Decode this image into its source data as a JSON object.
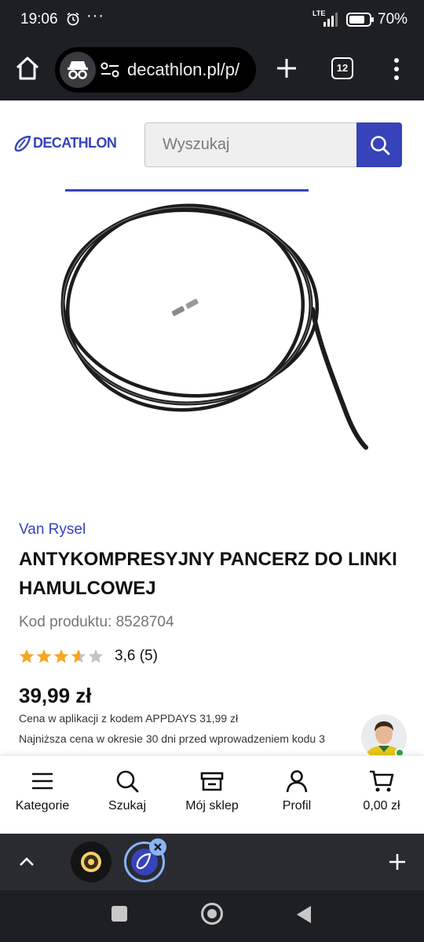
{
  "status_bar": {
    "time": "19:06",
    "network": "LTE",
    "battery": "70%",
    "more": "···"
  },
  "browser": {
    "url": "decathlon.pl/p/",
    "tab_count": "12"
  },
  "site": {
    "brand": "DECATHLON",
    "brand_color": "#3643ba",
    "search_placeholder": "Wyszukaj"
  },
  "product": {
    "brand": "Van Rysel",
    "title": "ANTYKOMPRESYJNY PANCERZ DO LINKI HAMULCOWEJ",
    "code": "Kod produktu: 8528704",
    "rating_value": 3.6,
    "rating_max": 5,
    "rating_text": "3,6 (5)",
    "price": "39,99 zł",
    "app_price_note": "Cena w aplikacji z kodem APPDAYS 31,99 zł",
    "lowest_price_note": "Najniższa cena w okresie 30 dni przed wprowadzeniem kodu 3"
  },
  "bottom_nav": {
    "items": [
      {
        "label": "Kategorie",
        "icon": "menu-icon"
      },
      {
        "label": "Szukaj",
        "icon": "search-icon"
      },
      {
        "label": "Mój sklep",
        "icon": "store-icon"
      },
      {
        "label": "Profil",
        "icon": "profile-icon"
      },
      {
        "label": "0,00 zł",
        "icon": "cart-icon"
      }
    ]
  },
  "colors": {
    "status_bar_bg": "#1e1f24",
    "star_filled": "#f5a623",
    "star_empty": "#c4c4c4"
  }
}
